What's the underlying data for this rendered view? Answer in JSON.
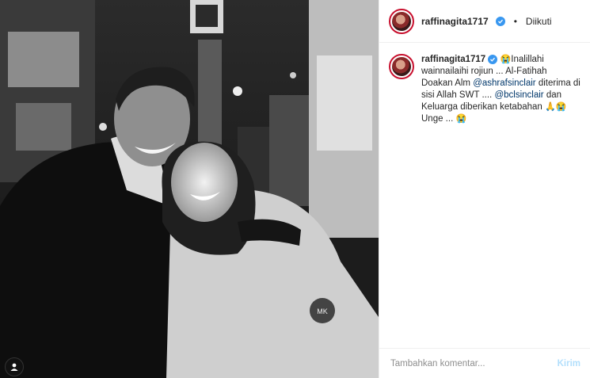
{
  "header": {
    "username": "raffinagita1717",
    "separator": "•",
    "follow_status": "Diikuti"
  },
  "caption": {
    "username": "raffinagita1717",
    "emoji_cry": "😭",
    "line1": "Inalillahi wainnailaihi rojiun ... Al-Fatihah Doakan Alm ",
    "mention1": "@ashrafsinclair",
    "line2": " diterima di sisi Allah SWT .... ",
    "mention2": "@bclsinclair",
    "line3": " dan Keluarga diberikan ketabahan ",
    "emoji_pray": "🙏",
    "line4": " Unge ... "
  },
  "composer": {
    "placeholder": "Tambahkan komentar...",
    "send_label": "Kirim"
  },
  "colors": {
    "verified": "#3897f0",
    "mention": "#00376b",
    "send_disabled": "#b2dffc",
    "story_ring": "#c8102e"
  },
  "icons": {
    "verified": "verified-badge-icon",
    "tag": "user-tag-icon"
  }
}
